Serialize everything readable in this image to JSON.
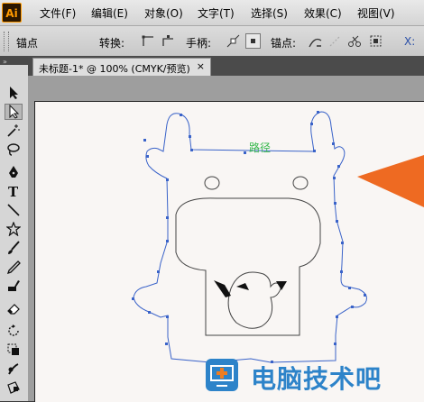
{
  "app": {
    "logo_text": "Ai"
  },
  "menu": {
    "items": [
      "文件(F)",
      "编辑(E)",
      "对象(O)",
      "文字(T)",
      "选择(S)",
      "效果(C)",
      "视图(V)"
    ]
  },
  "options_bar": {
    "anchor_label": "锚点",
    "convert_label": "转换:",
    "handles_label": "手柄:",
    "anchors_label": "锚点:",
    "trailing_text": "X:"
  },
  "document": {
    "tab_title": "未标题-1* @ 100% (CMYK/预览)",
    "close_glyph": "×"
  },
  "canvas": {
    "path_hint_label": "路径"
  },
  "watermark": {
    "text": "电脑技术吧"
  },
  "colors": {
    "path_stroke": "#3a63c9",
    "hint_text": "#37b84c",
    "arrow": "#ee6a22",
    "watermark_blue": "#2d83c9",
    "watermark_orange": "#ef7d21"
  },
  "tools": [
    {
      "name": "selection-tool",
      "active": false
    },
    {
      "name": "direct-selection-tool",
      "active": true
    },
    {
      "name": "magic-wand-tool",
      "active": false
    },
    {
      "name": "lasso-tool",
      "active": false
    },
    {
      "name": "pen-tool",
      "active": false
    },
    {
      "name": "type-tool",
      "active": false
    },
    {
      "name": "line-tool",
      "active": false
    },
    {
      "name": "star-tool",
      "active": false
    },
    {
      "name": "paintbrush-tool",
      "active": false
    },
    {
      "name": "pencil-tool",
      "active": false
    },
    {
      "name": "blob-brush-tool",
      "active": false
    },
    {
      "name": "eraser-tool",
      "active": false
    },
    {
      "name": "rotate-tool",
      "active": false
    },
    {
      "name": "scale-tool",
      "active": false
    },
    {
      "name": "warp-tool",
      "active": false
    },
    {
      "name": "free-transform-tool",
      "active": false
    }
  ]
}
